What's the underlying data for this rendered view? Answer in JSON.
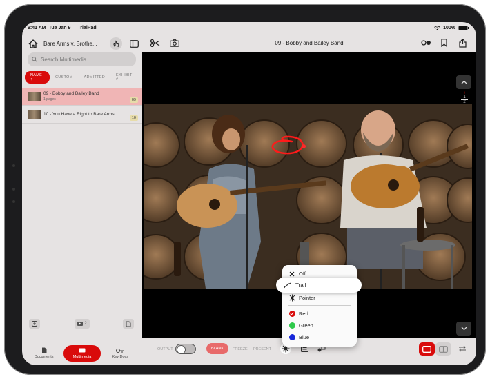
{
  "status": {
    "time": "9:41 AM",
    "date": "Tue Jan 9",
    "app": "TrialPad",
    "battery": "100%"
  },
  "sidebar": {
    "case_title": "Bare Arms v. Brothe...",
    "search_placeholder": "Search Multimedia",
    "sort_tabs": [
      {
        "label": "NAME ↑",
        "active": true
      },
      {
        "label": "CUSTOM",
        "active": false
      },
      {
        "label": "ADMITTED",
        "active": false
      },
      {
        "label": "EXHIBIT #",
        "active": false
      }
    ],
    "items": [
      {
        "name": "09 - Bobby and Bailey Band",
        "sub": "1 pages",
        "badge": "09",
        "selected": true
      },
      {
        "name": "10 - You Have a Right to Bare Arms",
        "sub": "",
        "badge": "10",
        "selected": false
      }
    ],
    "footer_count": "2",
    "tabs": [
      {
        "label": "Documents",
        "active": false
      },
      {
        "label": "Multimedia",
        "active": true
      },
      {
        "label": "Key Docs",
        "active": false
      }
    ]
  },
  "main": {
    "title": "09 - Bobby and Bailey Band",
    "pager_current": "1",
    "pager_total": "2",
    "bottom": {
      "output_label": "OUTPUT",
      "blank": "BLANK",
      "freeze": "FREEZE",
      "present": "PRESENT"
    }
  },
  "pointer_menu": {
    "items": [
      {
        "label": "Off",
        "icon": "close-icon"
      },
      {
        "label": "Trail",
        "icon": "trail-icon"
      },
      {
        "label": "Pointer",
        "icon": "pointer-burst-icon"
      }
    ],
    "colors": [
      {
        "label": "Red",
        "color": "#d90b0b",
        "selected": true
      },
      {
        "label": "Green",
        "color": "#2fc94b"
      },
      {
        "label": "Blue",
        "color": "#1627d9"
      }
    ]
  },
  "colors": {
    "accent": "#d90b0b",
    "sidebar_bg": "#e6e3e3"
  }
}
